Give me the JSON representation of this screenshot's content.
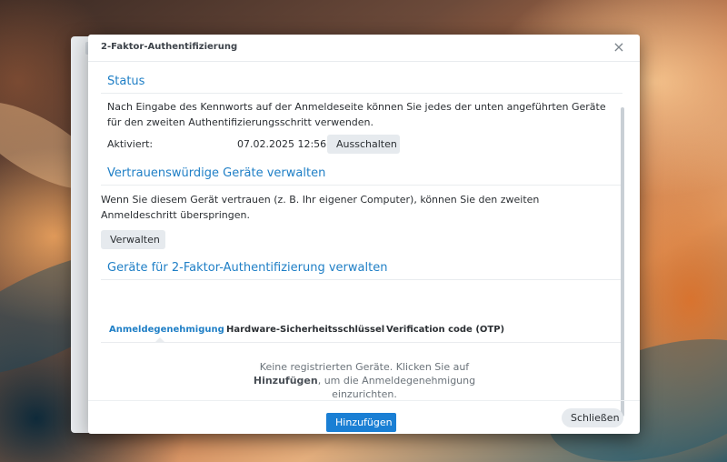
{
  "dialog": {
    "title": "2-Faktor-Authentifizierung",
    "close_symbol": "×"
  },
  "status": {
    "heading": "Status",
    "description": "Nach Eingabe des Kennworts auf der Anmeldeseite können Sie jedes der unten angeführten Geräte für den zweiten Authentifizierungsschritt verwenden.",
    "activated_label": "Aktiviert:",
    "activated_value": "07.02.2025 12:56",
    "disable_button": "Ausschalten"
  },
  "trusted": {
    "heading": "Vertrauenswürdige Geräte verwalten",
    "description": "Wenn Sie diesem Gerät vertrauen (z. B. Ihr eigener Computer), können Sie den zweiten Anmeldeschritt überspringen.",
    "manage_button": "Verwalten"
  },
  "devices": {
    "heading": "Geräte für 2-Faktor-Authentifizierung verwalten",
    "tabs": [
      {
        "label": "Anmeldegenehmigung",
        "active": true
      },
      {
        "label": "Hardware-Sicherheitsschlüssel",
        "active": false
      },
      {
        "label": "Verification code (OTP)",
        "active": false
      }
    ],
    "empty_line1": "Keine registrierten Geräte. Klicken Sie auf",
    "empty_bold": "Hinzufügen",
    "empty_line2_rest": ", um die Anmeldegenehmigung",
    "empty_line3": "einzurichten.",
    "add_button": "Hinzufügen"
  },
  "footer": {
    "close_button": "Schließen"
  },
  "colors": {
    "accent": "#1f7fc6",
    "primary_button": "#1a7fd4",
    "secondary_button": "#e6eaee"
  }
}
